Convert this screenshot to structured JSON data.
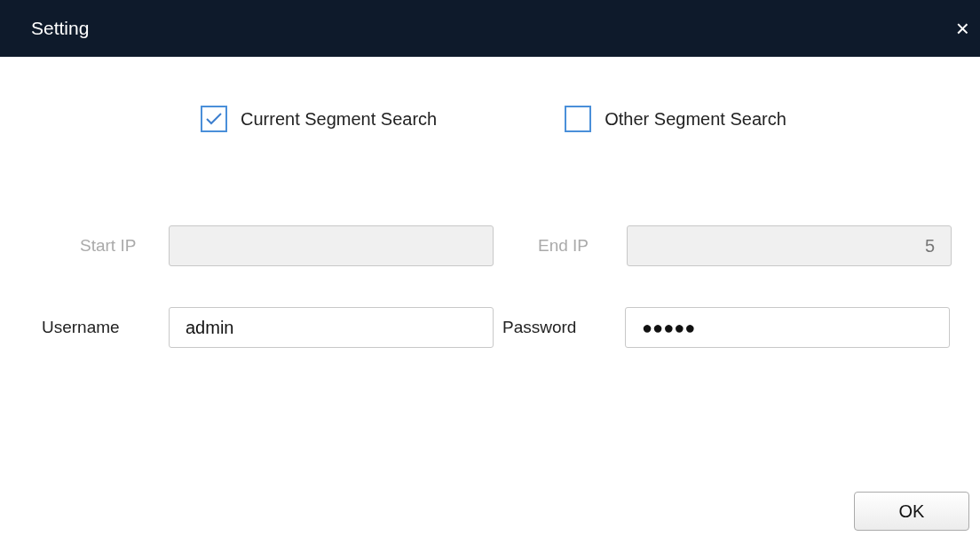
{
  "window": {
    "title": "Setting",
    "close": "×"
  },
  "search_modes": [
    {
      "label": "Current Segment Search",
      "checked": true
    },
    {
      "label": "Other Segment Search",
      "checked": false
    }
  ],
  "start_ip": {
    "label": "Start IP",
    "disabled": true
  },
  "end_ip": {
    "label": "End IP",
    "value": "5",
    "disabled": true
  },
  "username": {
    "label": "Username",
    "value": "admin"
  },
  "password": {
    "label": "Password",
    "value": "●●●●●"
  },
  "buttons": [
    "OK"
  ]
}
